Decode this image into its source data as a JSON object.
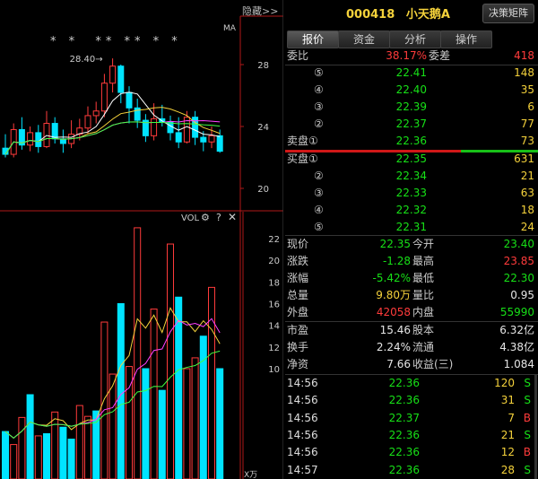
{
  "stock": {
    "code": "000418",
    "name": "小天鹅A"
  },
  "decision_button": "决策矩阵",
  "hide_label": "隐藏>>",
  "tabs": [
    "报价",
    "资金",
    "分析",
    "操作"
  ],
  "weibi": {
    "label": "委比",
    "value": "38.17%",
    "diff_label": "委差",
    "diff": "418"
  },
  "sell": [
    {
      "label": "⑤",
      "price": "22.41",
      "vol": "148"
    },
    {
      "label": "④",
      "price": "22.40",
      "vol": "35"
    },
    {
      "label": "③",
      "price": "22.39",
      "vol": "6"
    },
    {
      "label": "②",
      "price": "22.37",
      "vol": "77"
    },
    {
      "label": "卖盘①",
      "price": "22.36",
      "vol": "73"
    }
  ],
  "buy": [
    {
      "label": "买盘①",
      "price": "22.35",
      "vol": "631"
    },
    {
      "label": "②",
      "price": "22.34",
      "vol": "21"
    },
    {
      "label": "③",
      "price": "22.33",
      "vol": "63"
    },
    {
      "label": "④",
      "price": "22.32",
      "vol": "18"
    },
    {
      "label": "⑤",
      "price": "22.31",
      "vol": "24"
    }
  ],
  "quote": [
    {
      "l1": "现价",
      "v1": "22.35",
      "c1": "green",
      "l2": "今开",
      "v2": "23.40",
      "c2": "green"
    },
    {
      "l1": "涨跌",
      "v1": "-1.28",
      "c1": "green",
      "l2": "最高",
      "v2": "23.85",
      "c2": "red"
    },
    {
      "l1": "涨幅",
      "v1": "-5.42%",
      "c1": "green",
      "l2": "最低",
      "v2": "22.30",
      "c2": "green"
    },
    {
      "l1": "总量",
      "v1": "9.80万",
      "c1": "yellow",
      "l2": "量比",
      "v2": "0.95",
      "c2": "white"
    },
    {
      "l1": "外盘",
      "v1": "42058",
      "c1": "red",
      "l2": "内盘",
      "v2": "55990",
      "c2": "green"
    }
  ],
  "fundamentals": [
    {
      "l1": "市盈",
      "v1": "15.46",
      "l2": "股本",
      "v2": "6.32亿"
    },
    {
      "l1": "换手",
      "v1": "2.24%",
      "l2": "流通",
      "v2": "4.38亿"
    },
    {
      "l1": "净资",
      "v1": "7.66",
      "l2": "收益(三)",
      "v2": "1.084"
    }
  ],
  "ticks": [
    {
      "time": "14:56",
      "price": "22.36",
      "vol": "120",
      "side": "S"
    },
    {
      "time": "14:56",
      "price": "22.36",
      "vol": "31",
      "side": "S"
    },
    {
      "time": "14:56",
      "price": "22.37",
      "vol": "7",
      "side": "B"
    },
    {
      "time": "14:56",
      "price": "22.36",
      "vol": "21",
      "side": "S"
    },
    {
      "time": "14:56",
      "price": "22.36",
      "vol": "12",
      "side": "B"
    },
    {
      "time": "14:57",
      "price": "22.36",
      "vol": "28",
      "side": "S"
    }
  ],
  "kchart": {
    "ma_label": "MA",
    "stars": "* *  ** ** * *",
    "high_annotation": "28.40",
    "price_axis": [
      "28",
      "24",
      "20"
    ],
    "candles": [
      {
        "o": 22.6,
        "c": 22.2,
        "h": 23.5,
        "l": 22.0
      },
      {
        "o": 22.2,
        "c": 23.8,
        "h": 24.2,
        "l": 22.0
      },
      {
        "o": 23.8,
        "c": 22.8,
        "h": 24.6,
        "l": 22.5
      },
      {
        "o": 22.8,
        "c": 23.6,
        "h": 24.0,
        "l": 22.4
      },
      {
        "o": 23.6,
        "c": 22.7,
        "h": 24.1,
        "l": 22.3
      },
      {
        "o": 22.7,
        "c": 24.2,
        "h": 25.0,
        "l": 22.6
      },
      {
        "o": 24.2,
        "c": 23.2,
        "h": 24.6,
        "l": 22.9
      },
      {
        "o": 23.2,
        "c": 22.9,
        "h": 23.8,
        "l": 22.3
      },
      {
        "o": 22.9,
        "c": 23.5,
        "h": 24.4,
        "l": 22.6
      },
      {
        "o": 23.5,
        "c": 23.9,
        "h": 24.5,
        "l": 23.1
      },
      {
        "o": 23.9,
        "c": 24.7,
        "h": 25.3,
        "l": 23.5
      },
      {
        "o": 24.7,
        "c": 25.0,
        "h": 25.6,
        "l": 24.2
      },
      {
        "o": 25.0,
        "c": 26.8,
        "h": 27.4,
        "l": 24.6
      },
      {
        "o": 26.8,
        "c": 27.9,
        "h": 28.4,
        "l": 26.2
      },
      {
        "o": 27.9,
        "c": 26.2,
        "h": 28.0,
        "l": 25.5
      },
      {
        "o": 26.2,
        "c": 25.2,
        "h": 26.6,
        "l": 24.2
      },
      {
        "o": 25.2,
        "c": 24.4,
        "h": 25.8,
        "l": 23.9
      },
      {
        "o": 24.4,
        "c": 23.4,
        "h": 24.8,
        "l": 23.0
      },
      {
        "o": 23.4,
        "c": 24.5,
        "h": 25.5,
        "l": 23.1
      },
      {
        "o": 24.5,
        "c": 24.3,
        "h": 25.4,
        "l": 24.0
      },
      {
        "o": 24.3,
        "c": 23.6,
        "h": 24.7,
        "l": 23.1
      },
      {
        "o": 23.6,
        "c": 23.0,
        "h": 24.6,
        "l": 22.6
      },
      {
        "o": 23.0,
        "c": 24.6,
        "h": 25.0,
        "l": 22.9
      },
      {
        "o": 24.6,
        "c": 23.3,
        "h": 25.0,
        "l": 22.8
      },
      {
        "o": 23.3,
        "c": 23.0,
        "h": 23.7,
        "l": 22.4
      },
      {
        "o": 23.0,
        "c": 23.4,
        "h": 24.0,
        "l": 22.6
      },
      {
        "o": 23.4,
        "c": 22.4,
        "h": 23.8,
        "l": 22.3
      }
    ]
  },
  "volchart": {
    "title": "VOL",
    "axis": [
      "22",
      "20",
      "18",
      "16",
      "14",
      "12",
      "10"
    ],
    "unit_label": "X万",
    "bars": [
      4.2,
      3.0,
      5.5,
      7.6,
      3.8,
      4.0,
      6.0,
      4.6,
      3.5,
      6.6,
      5.6,
      6.1,
      14.3,
      9.5,
      16.0,
      10.2,
      23.0,
      10.0,
      15.5,
      8.0,
      21.5,
      16.6,
      10.0,
      11.0,
      13.0,
      17.5,
      10.0
    ],
    "dirs": [
      "g",
      "r",
      "r",
      "g",
      "r",
      "g",
      "r",
      "g",
      "g",
      "r",
      "r",
      "g",
      "r",
      "r",
      "g",
      "r",
      "r",
      "g",
      "r",
      "g",
      "r",
      "g",
      "r",
      "r",
      "g",
      "r",
      "g"
    ]
  }
}
